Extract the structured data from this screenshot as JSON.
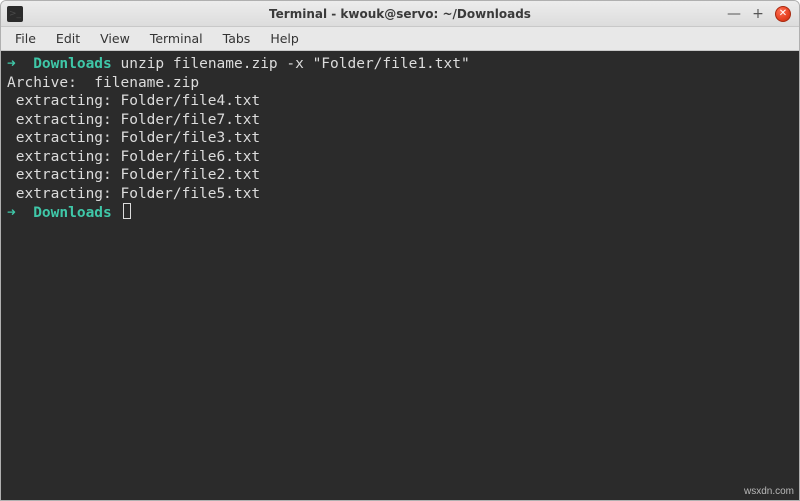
{
  "window": {
    "title": "Terminal - kwouk@servo: ~/Downloads",
    "controls": {
      "minimize": "—",
      "maximize": "+",
      "close": "✕"
    }
  },
  "menu": {
    "file": "File",
    "edit": "Edit",
    "view": "View",
    "terminal": "Terminal",
    "tabs": "Tabs",
    "help": "Help"
  },
  "terminal": {
    "prompt_arrow": "➜",
    "prompt_dir": "Downloads",
    "command": "unzip filename.zip -x \"Folder/file1.txt\"",
    "archive_line": "Archive:  filename.zip",
    "extract_lines": [
      " extracting: Folder/file4.txt",
      " extracting: Folder/file7.txt",
      " extracting: Folder/file3.txt",
      " extracting: Folder/file6.txt",
      " extracting: Folder/file2.txt",
      " extracting: Folder/file5.txt"
    ]
  },
  "watermark": "wsxdn.com"
}
